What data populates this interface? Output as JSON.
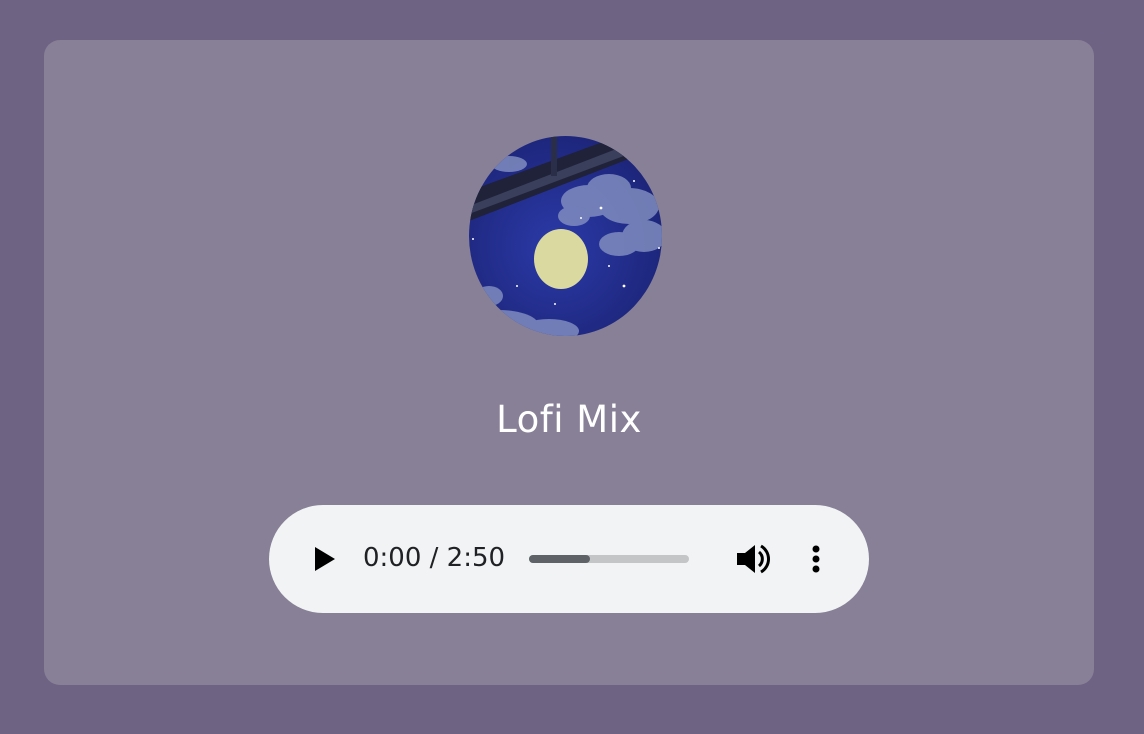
{
  "track": {
    "title": "Lofi Mix",
    "cover_icon": "night-moon-artwork"
  },
  "player": {
    "current_time": "0:00",
    "duration": "2:50",
    "time_display": "0:00 / 2:50",
    "progress_fraction": 0.38,
    "play_icon": "play-icon",
    "volume_icon": "volume-icon",
    "more_icon": "more-vert-icon"
  },
  "colors": {
    "page_background": "#6f6383",
    "card_background": "#888097",
    "player_background": "#f1f3f4",
    "title_text": "#ffffff"
  }
}
